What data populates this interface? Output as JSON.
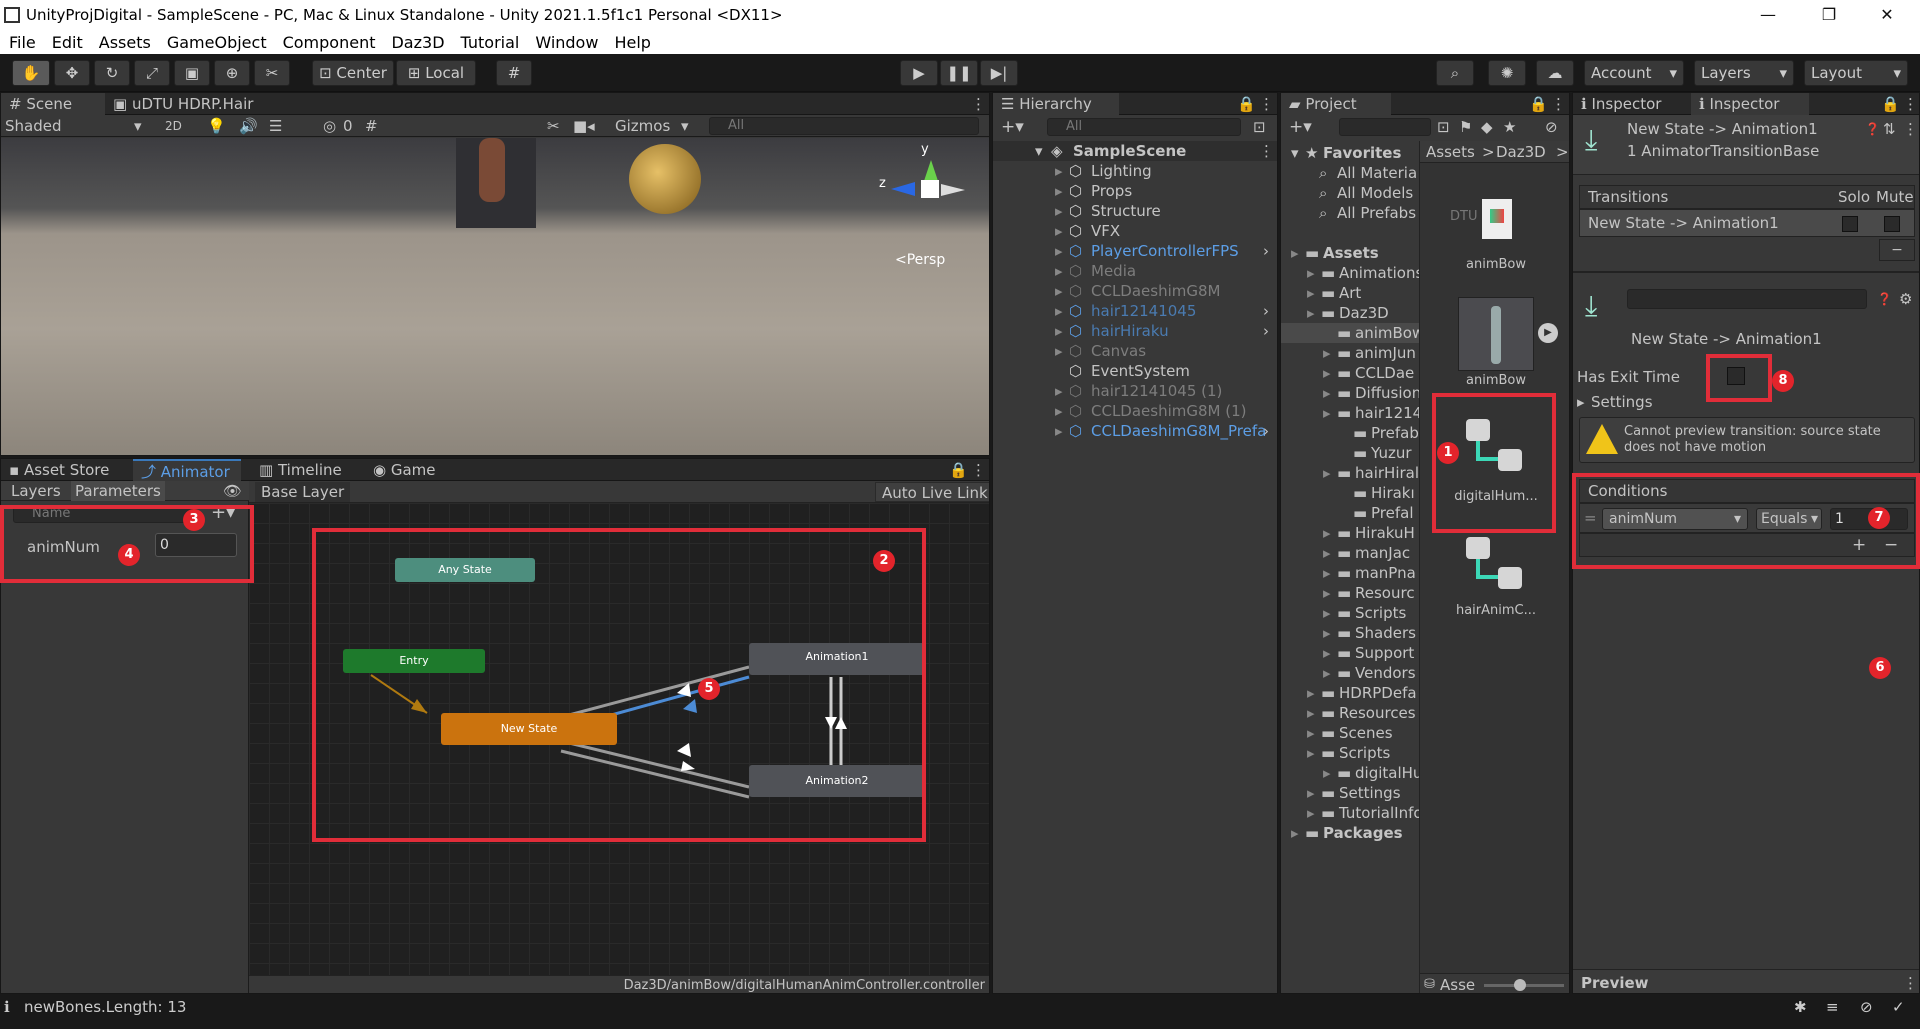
{
  "window": {
    "title": "UnityProjDigital - SampleScene - PC, Mac & Linux Standalone - Unity 2021.1.5f1c1 Personal <DX11>",
    "minimize": "—",
    "restore": "❐",
    "close": "✕"
  },
  "menu": [
    "File",
    "Edit",
    "Assets",
    "GameObject",
    "Component",
    "Daz3D",
    "Tutorial",
    "Window",
    "Help"
  ],
  "toolbar": {
    "center": "Center",
    "local": "Local",
    "account": "Account",
    "layers": "Layers",
    "layout": "Layout"
  },
  "scene": {
    "tabs": [
      "Scene",
      "uDTU HDRP.Hair"
    ],
    "shaded": "Shaded",
    "mode2d": "2D",
    "vis_count": "0",
    "gizmos": "Gizmos",
    "search_placeholder": "All",
    "persp": "<Persp",
    "axis_y": "y",
    "axis_z": "z"
  },
  "animator": {
    "tabs": [
      "Asset Store",
      "Animator",
      "Timeline",
      "Game"
    ],
    "layers_tab": "Layers",
    "params_tab": "Parameters",
    "base_layer": "Base Layer",
    "auto_live": "Auto Live Link",
    "name_placeholder": "Name",
    "param_name": "animNum",
    "param_value": "0",
    "path": "Daz3D/animBow/digitalHumanAnimController.controller",
    "nodes": {
      "any": "Any State",
      "entry": "Entry",
      "newstate": "New State",
      "anim1": "Animation1",
      "anim2": "Animation2"
    }
  },
  "hierarchy": {
    "title": "Hierarchy",
    "search_placeholder": "All",
    "scene": "SampleScene",
    "items": [
      {
        "label": "Lighting",
        "style": "normal",
        "arrow": true
      },
      {
        "label": "Props",
        "style": "normal",
        "arrow": true
      },
      {
        "label": "Structure",
        "style": "normal",
        "arrow": true
      },
      {
        "label": "VFX",
        "style": "normal",
        "arrow": true
      },
      {
        "label": "PlayerControllerFPS",
        "style": "blue",
        "arrow": true
      },
      {
        "label": "Media",
        "style": "dim",
        "arrow": true
      },
      {
        "label": "CCLDaeshimG8M",
        "style": "dim",
        "arrow": true
      },
      {
        "label": "hair12141045",
        "style": "blue-dim",
        "arrow": true
      },
      {
        "label": "hairHiraku",
        "style": "blue-dim",
        "arrow": true
      },
      {
        "label": "Canvas",
        "style": "dim",
        "arrow": true
      },
      {
        "label": "EventSystem",
        "style": "normal",
        "arrow": false
      },
      {
        "label": "hair12141045 (1)",
        "style": "dim",
        "arrow": true
      },
      {
        "label": "CCLDaeshimG8M (1)",
        "style": "dim",
        "arrow": true
      },
      {
        "label": "CCLDaeshimG8M_Prefa",
        "style": "blue",
        "arrow": true
      }
    ]
  },
  "project": {
    "title": "Project",
    "favorites": "Favorites",
    "fav_items": [
      "All Materia",
      "All Models",
      "All Prefabs"
    ],
    "tree": [
      {
        "label": "Assets",
        "indent": 0,
        "bold": true
      },
      {
        "label": "Animations",
        "indent": 1
      },
      {
        "label": "Art",
        "indent": 1
      },
      {
        "label": "Daz3D",
        "indent": 1
      },
      {
        "label": "animBow",
        "indent": 2,
        "sel": true
      },
      {
        "label": "animJun",
        "indent": 2
      },
      {
        "label": "CCLDae",
        "indent": 2
      },
      {
        "label": "Diffusion",
        "indent": 2
      },
      {
        "label": "hair1214",
        "indent": 2
      },
      {
        "label": "Prefab",
        "indent": 3
      },
      {
        "label": "Yuzur",
        "indent": 3
      },
      {
        "label": "hairHiral",
        "indent": 2
      },
      {
        "label": "Hirakı",
        "indent": 3
      },
      {
        "label": "Prefal",
        "indent": 3
      },
      {
        "label": "HirakuH",
        "indent": 2
      },
      {
        "label": "manJac",
        "indent": 2
      },
      {
        "label": "manPna",
        "indent": 2
      },
      {
        "label": "Resourc",
        "indent": 2
      },
      {
        "label": "Scripts",
        "indent": 2
      },
      {
        "label": "Shaders",
        "indent": 2
      },
      {
        "label": "Support",
        "indent": 2
      },
      {
        "label": "Vendors",
        "indent": 2
      },
      {
        "label": "HDRPDefa",
        "indent": 1
      },
      {
        "label": "Resources",
        "indent": 1
      },
      {
        "label": "Scenes",
        "indent": 1
      },
      {
        "label": "Scripts",
        "indent": 1
      },
      {
        "label": "digitalHu",
        "indent": 2
      },
      {
        "label": "Settings",
        "indent": 1
      },
      {
        "label": "TutorialInfo",
        "indent": 1
      },
      {
        "label": "Packages",
        "indent": 0,
        "bold": true
      }
    ],
    "breadcrumb": [
      "Assets",
      "Daz3D"
    ],
    "assets": [
      {
        "label": "animBow"
      },
      {
        "label": "animBow"
      },
      {
        "label": "digitalHum..."
      },
      {
        "label": "hairAnimC..."
      }
    ],
    "dtu": "DTU",
    "asse": "Asse"
  },
  "inspector": {
    "tabs": [
      "Inspector",
      "Inspector"
    ],
    "header_title": "New State -> Animation1",
    "header_sub": "1 AnimatorTransitionBase",
    "transitions_label": "Transitions",
    "solo": "Solo",
    "mute": "Mute",
    "transition_row": "New State -> Animation1",
    "sub_title": "New State -> Animation1",
    "has_exit_time": "Has Exit Time",
    "settings": "Settings",
    "warning": "Cannot preview transition: source state does not have motion",
    "conditions": "Conditions",
    "cond_param": "animNum",
    "cond_op": "Equals",
    "cond_value": "1",
    "preview": "Preview"
  },
  "status": {
    "message": "newBones.Length: 13"
  },
  "badges": [
    "1",
    "2",
    "3",
    "4",
    "5",
    "6",
    "7",
    "8"
  ]
}
